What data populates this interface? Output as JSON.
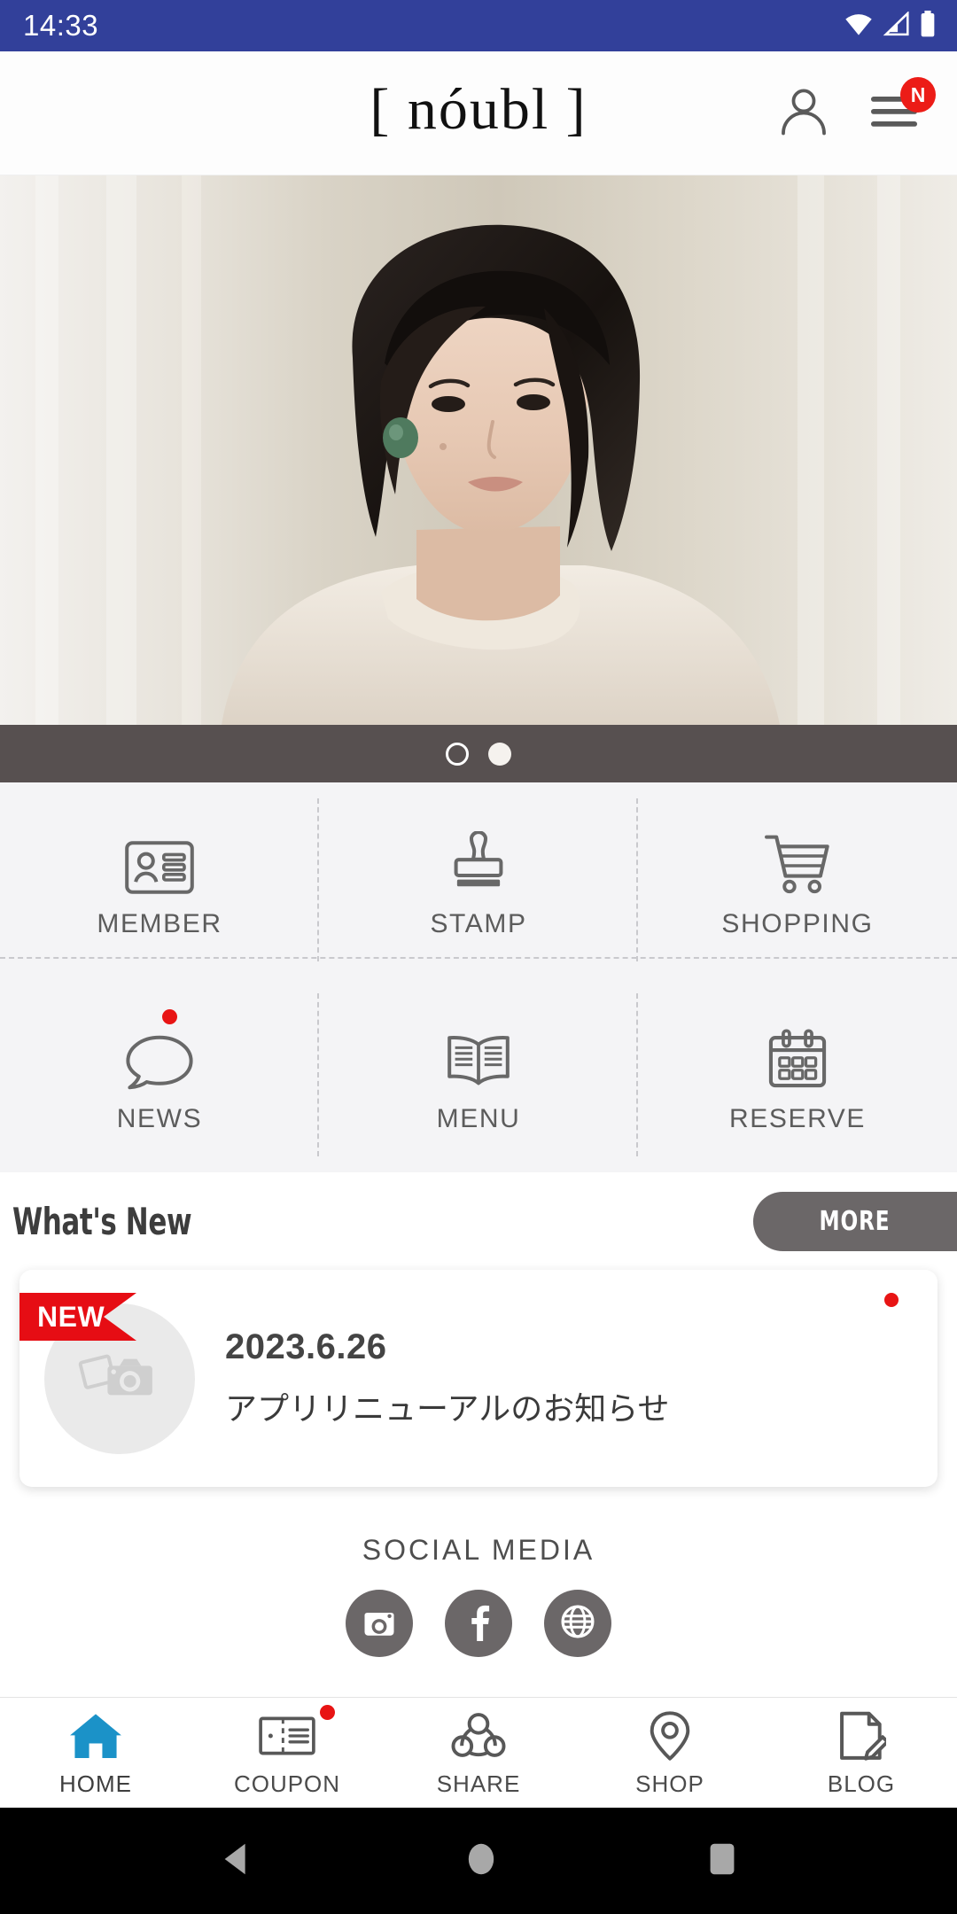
{
  "status_bar": {
    "time": "14:33",
    "background": "#32409A",
    "icons": [
      "wifi-icon",
      "cellular-signal-icon",
      "battery-icon"
    ]
  },
  "header": {
    "logo": "[ nóubl ]",
    "account_icon": "person-icon",
    "menu_icon": "hamburger-menu-icon",
    "menu_badge": "N",
    "badge_color": "#EC1C17"
  },
  "hero": {
    "alt": "woman-portrait-photo",
    "carousel": {
      "total": 2,
      "active_index": 1,
      "bar_color": "#575050"
    }
  },
  "grid": {
    "background": "#F4F4F6",
    "items": [
      {
        "label": "MEMBER",
        "icon": "id-card-icon",
        "badge": false
      },
      {
        "label": "STAMP",
        "icon": "rubber-stamp-icon",
        "badge": false
      },
      {
        "label": "SHOPPING",
        "icon": "shopping-cart-icon",
        "badge": false
      },
      {
        "label": "NEWS",
        "icon": "speech-bubble-icon",
        "badge": true
      },
      {
        "label": "MENU",
        "icon": "open-book-icon",
        "badge": false
      },
      {
        "label": "RESERVE",
        "icon": "calendar-icon",
        "badge": false
      }
    ]
  },
  "whats_new": {
    "heading": "What's New",
    "more_label": "MORE",
    "more_color": "#6B6768",
    "items": [
      {
        "ribbon": "NEW",
        "ribbon_color": "#E60D14",
        "date": "2023.6.26",
        "title": "アプリリニューアルのお知らせ",
        "thumbnail": "photo-camera-placeholder-icon",
        "unread": true
      }
    ]
  },
  "social_media": {
    "heading": "SOCIAL MEDIA",
    "circle_color": "#6B6768",
    "links": [
      {
        "name": "instagram-icon"
      },
      {
        "name": "facebook-icon"
      },
      {
        "name": "website-globe-icon"
      }
    ]
  },
  "tab_bar": {
    "active_color": "#1B92C8",
    "inactive_color": "#4B4B4B",
    "tabs": [
      {
        "label": "HOME",
        "icon": "home-icon",
        "active": true,
        "badge": false
      },
      {
        "label": "COUPON",
        "icon": "ticket-icon",
        "active": false,
        "badge": true
      },
      {
        "label": "SHARE",
        "icon": "share-nodes-icon",
        "active": false,
        "badge": false
      },
      {
        "label": "SHOP",
        "icon": "map-pin-icon",
        "active": false,
        "badge": false
      },
      {
        "label": "BLOG",
        "icon": "document-pencil-icon",
        "active": false,
        "badge": false
      }
    ]
  },
  "android_nav": {
    "back": "back-triangle-icon",
    "home": "home-circle-icon",
    "recents": "recents-square-icon"
  }
}
